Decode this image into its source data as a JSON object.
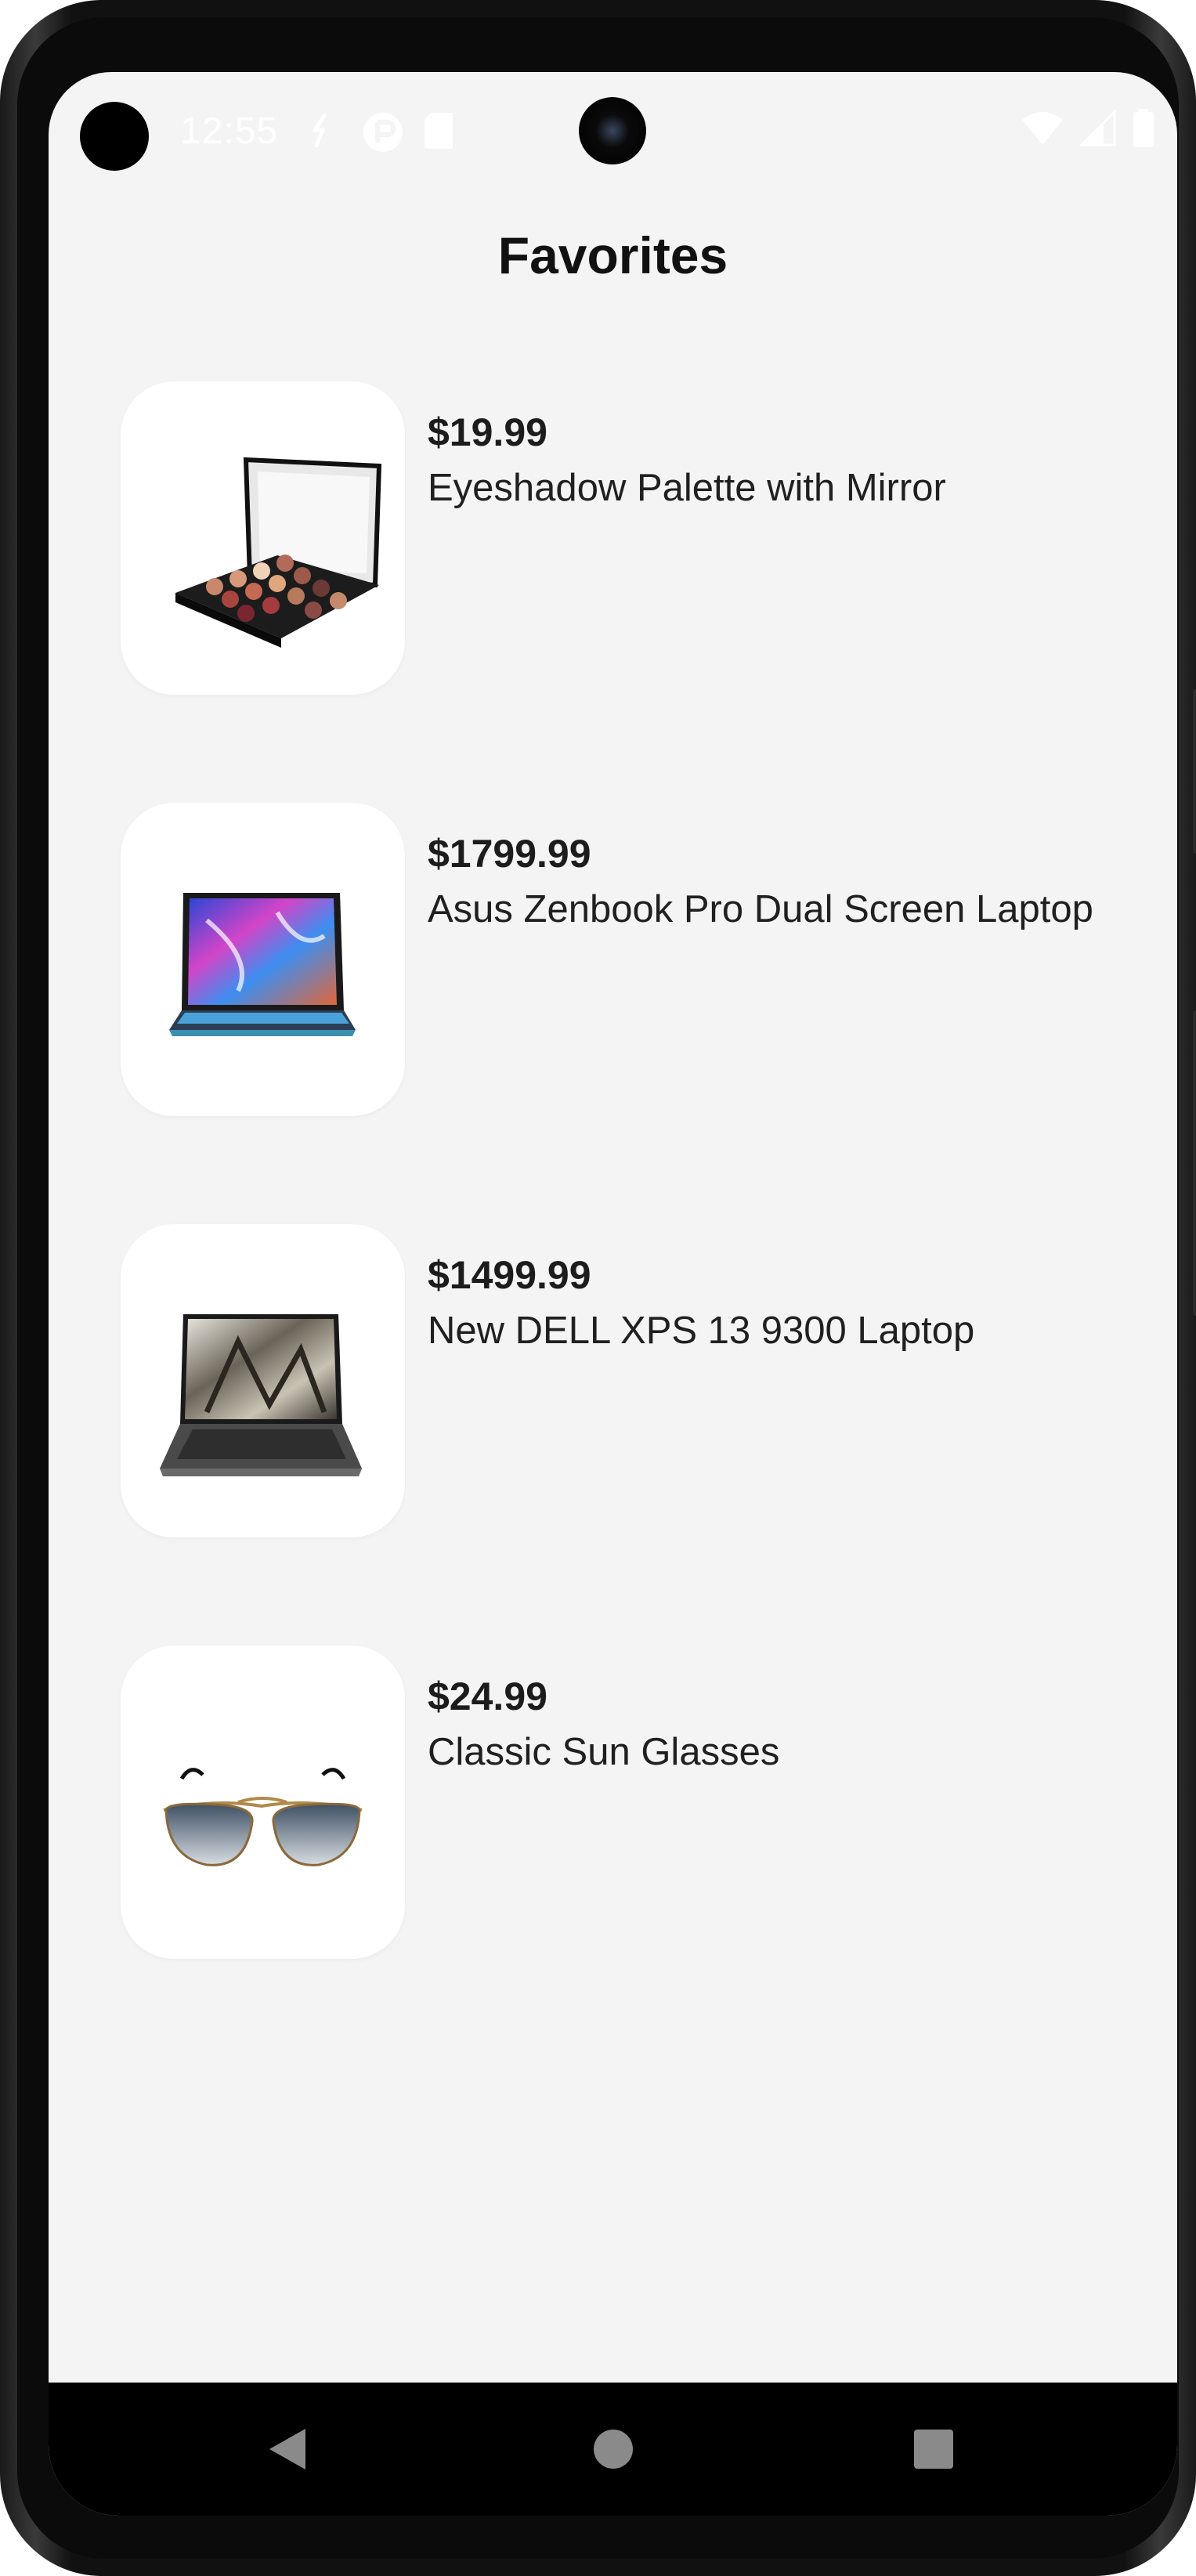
{
  "status_bar": {
    "time": "12:55",
    "icons": [
      "sync-icon",
      "cursor-app-icon",
      "sd-card-icon",
      "wifi-icon",
      "signal-icon",
      "battery-icon"
    ]
  },
  "header": {
    "title": "Favorites"
  },
  "favorites": [
    {
      "price": "$19.99",
      "name": "Eyeshadow Palette with Mirror",
      "image": "eyeshadow-palette"
    },
    {
      "price": "$1799.99",
      "name": "Asus Zenbook Pro Dual Screen Laptop",
      "image": "asus-laptop"
    },
    {
      "price": "$1499.99",
      "name": "New DELL XPS 13 9300 Laptop",
      "image": "dell-laptop"
    },
    {
      "price": "$24.99",
      "name": "Classic Sun Glasses",
      "image": "sunglasses"
    }
  ],
  "nav_bar": {
    "buttons": [
      "back-icon",
      "home-icon",
      "recents-icon"
    ]
  },
  "colors": {
    "screen_background": "#f4f4f4",
    "card_background": "#ffffff",
    "text_primary": "#1c1c1c",
    "nav_background": "#000000"
  }
}
